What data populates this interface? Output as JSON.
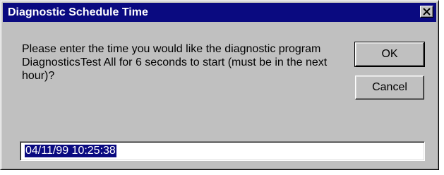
{
  "dialog": {
    "title": "Diagnostic Schedule Time",
    "message": "Please enter the time you would like the diagnostic program DiagnosticsTest All for 6 seconds to start (must be in the next hour)?",
    "ok_label": "OK",
    "cancel_label": "Cancel",
    "time_input": {
      "value": "04/11/99 10:25:38",
      "selected": true
    },
    "close_icon": "close-icon"
  },
  "colors": {
    "titlebar": "#0a0a80",
    "face": "#c0c0c0",
    "selection": "#0a0a80"
  }
}
